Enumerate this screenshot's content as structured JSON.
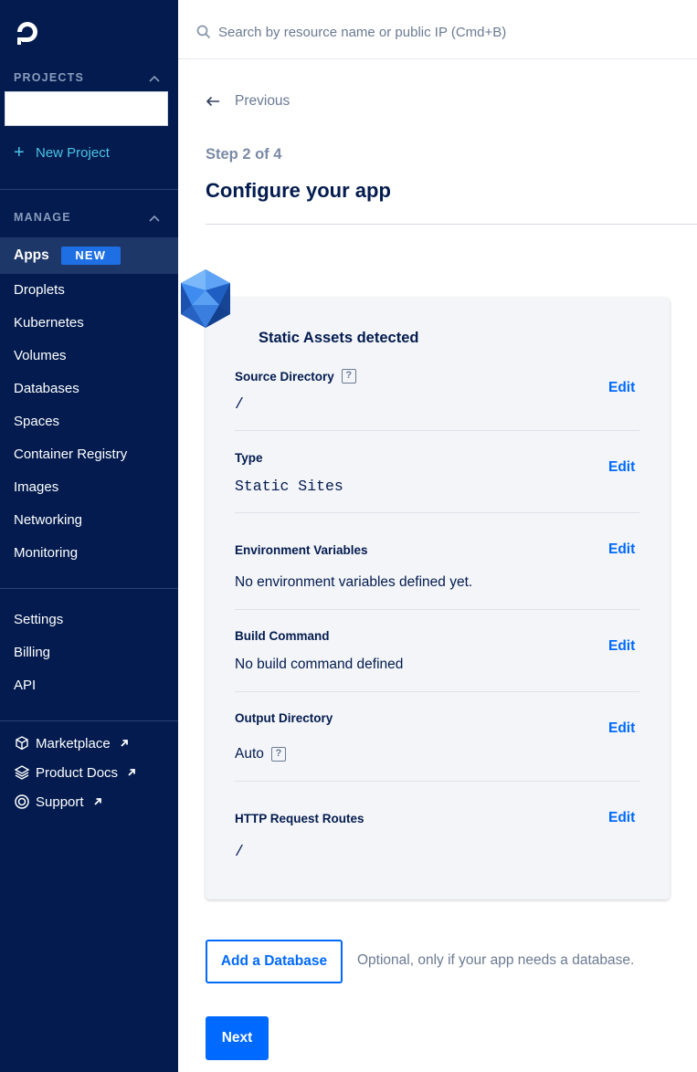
{
  "sidebar": {
    "logo_icon": "digitalocean-logo-icon",
    "projects_heading": "PROJECTS",
    "new_project_label": "New Project",
    "manage_heading": "MANAGE",
    "apps_label": "Apps",
    "apps_badge": "NEW",
    "nav_items": [
      "Droplets",
      "Kubernetes",
      "Volumes",
      "Databases",
      "Spaces",
      "Container Registry",
      "Images",
      "Networking",
      "Monitoring"
    ],
    "account_items": [
      "Settings",
      "Billing",
      "API"
    ],
    "external_links": [
      {
        "label": "Marketplace",
        "icon": "cube-icon"
      },
      {
        "label": "Product Docs",
        "icon": "layers-icon"
      },
      {
        "label": "Support",
        "icon": "lifebuoy-icon"
      }
    ],
    "colors": {
      "background": "#031b4e",
      "accent": "#4cc3e8",
      "badge": "#1f6fe4"
    }
  },
  "search": {
    "placeholder": "Search by resource name or public IP (Cmd+B)"
  },
  "main": {
    "previous_label": "Previous",
    "step_label": "Step 2 of 4",
    "title": "Configure your app",
    "card": {
      "title": "Static Assets detected",
      "fields": [
        {
          "label": "Source Directory",
          "value": "/",
          "edit": "Edit",
          "help": "?"
        },
        {
          "label": "Type",
          "value": "Static Sites",
          "edit": "Edit"
        },
        {
          "label": "Environment Variables",
          "value": "No environment variables defined yet.",
          "edit": "Edit"
        },
        {
          "label": "Build Command",
          "value": "No build command defined",
          "edit": "Edit"
        },
        {
          "label": "Output Directory",
          "value": "Auto",
          "edit": "Edit",
          "help": "?"
        },
        {
          "label": "HTTP Request Routes",
          "value": "/",
          "edit": "Edit"
        }
      ]
    },
    "add_database_label": "Add a Database",
    "add_database_note": "Optional, only if your app needs a database.",
    "next_label": "Next",
    "colors": {
      "primary": "#0069ff",
      "text": "#031b4e",
      "muted": "#6b7a93"
    }
  }
}
